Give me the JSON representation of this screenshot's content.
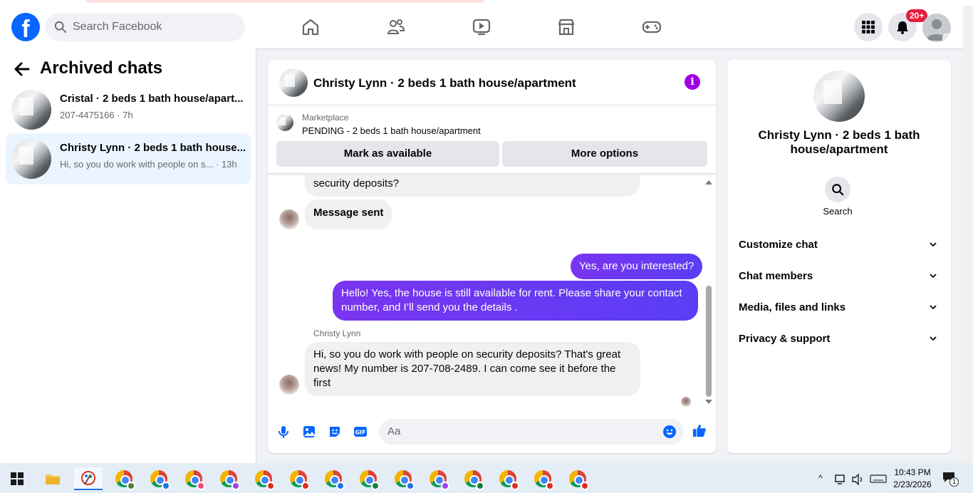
{
  "header": {
    "search_placeholder": "Search Facebook",
    "notification_badge": "20+",
    "logo_letter": "f"
  },
  "left_panel": {
    "title": "Archived chats",
    "chats": [
      {
        "name": "Cristal · 2 beds 1 bath house/apart...",
        "sub": "207-4475166 · 7h",
        "active": false
      },
      {
        "name": "Christy Lynn · 2 beds 1 bath house...",
        "sub": "Hi, so you do work with people on s... · 13h",
        "active": true
      }
    ]
  },
  "conversation": {
    "title": "Christy Lynn · 2 beds 1 bath house/apartment",
    "marketplace_label": "Marketplace",
    "listing_status": "PENDING - 2 beds 1 bath house/apartment",
    "mark_available_label": "Mark as available",
    "more_options_label": "More options",
    "messages": {
      "partial_in": "security deposits?",
      "sent_notice": "Message sent",
      "out_1": "Yes, are you interested?",
      "out_2": "Hello! Yes, the house is still available for rent. Please share your contact number, and I’ll send you the details .",
      "sender_name": "Christy Lynn",
      "in_last": "Hi, so you do work with people on security deposits? That's great news! My number is 207-708-2489. I can come see it before the first"
    },
    "composer_placeholder": "Aa"
  },
  "right_panel": {
    "title": "Christy Lynn · 2 beds 1 bath house/apartment",
    "search_label": "Search",
    "sections": [
      "Customize chat",
      "Chat members",
      "Media, files and links",
      "Privacy & support"
    ]
  },
  "taskbar": {
    "time": "10:43 PM",
    "date": "2/23/2026",
    "notification_count": "1",
    "chrome_profile_colors": [
      "#4f7d3a",
      "#1a73e8",
      "#e84c8b",
      "#a142f4",
      "#d93025",
      "#d93025",
      "#1a73e8",
      "#188038",
      "#1a73e8",
      "#a142f4",
      "#188038",
      "#d93025",
      "#d93025",
      "#d93025"
    ]
  },
  "colors": {
    "brand_blue": "#0866ff",
    "outgoing_bubble": "#6a3df0",
    "info_purple": "#a100e6",
    "active_chat_bg": "#ebf5ff",
    "composer_blue": "#0866ff"
  }
}
